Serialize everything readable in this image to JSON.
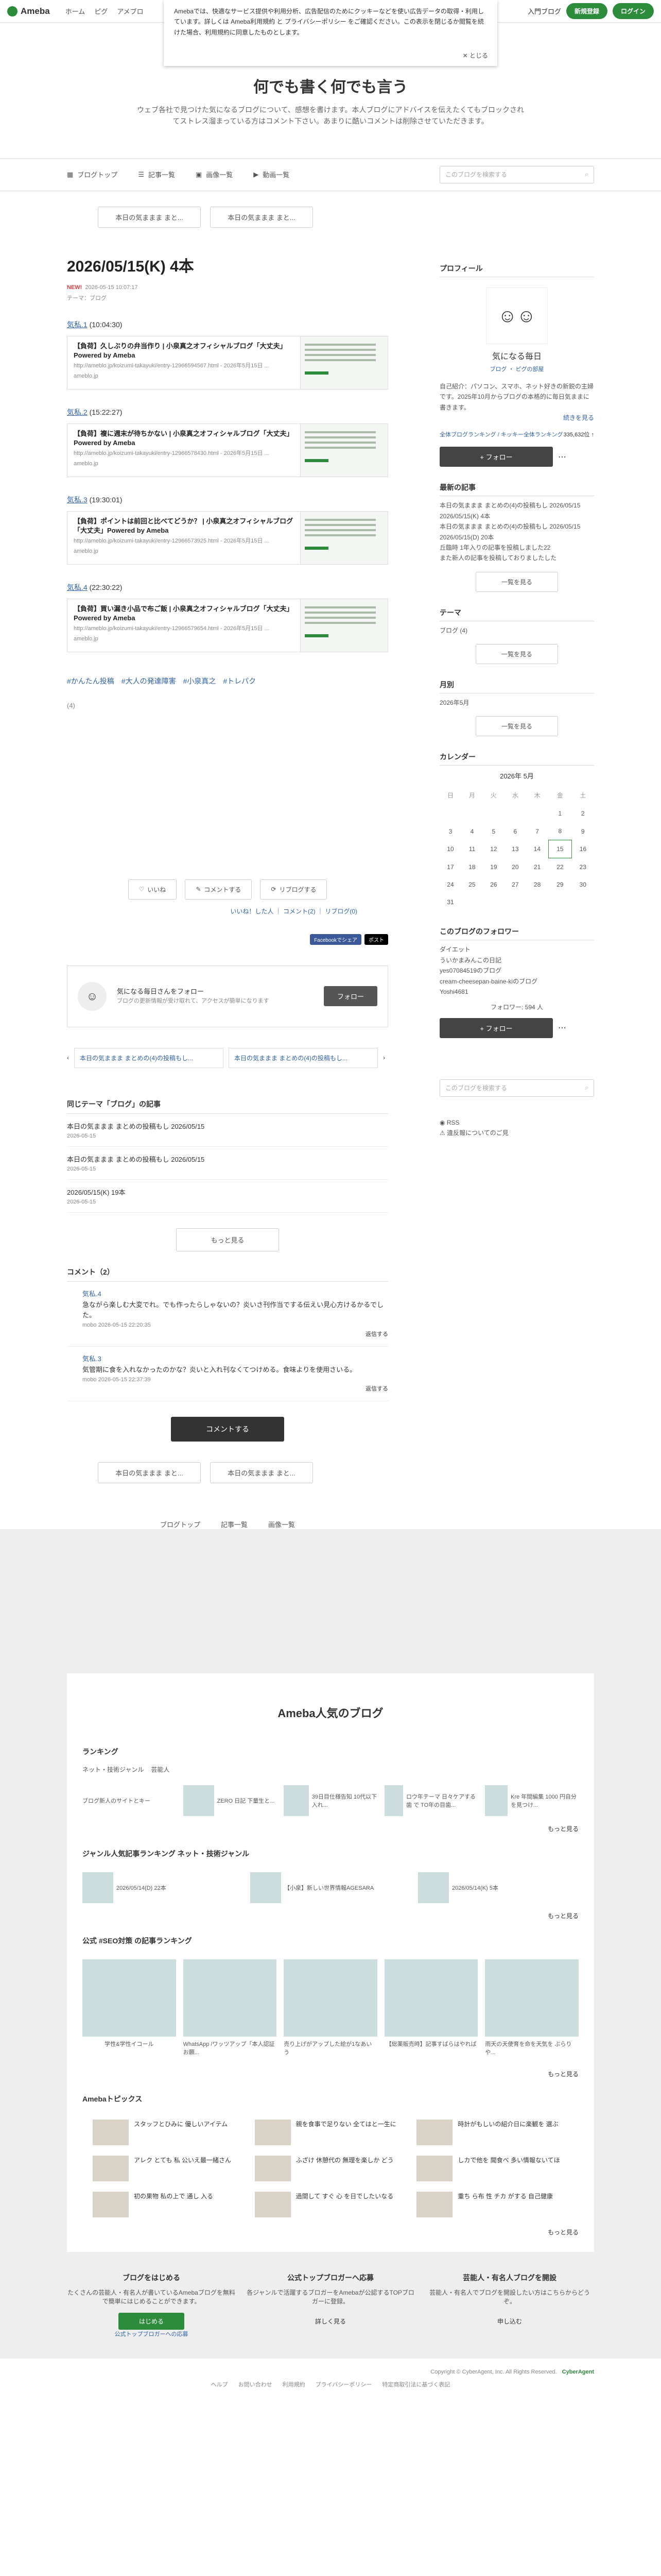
{
  "topbar": {
    "logo": "Ameba",
    "nav": [
      "ホーム",
      "ピグ",
      "アメブロ"
    ],
    "login_link": "入門ブログ",
    "register": "新規登録",
    "login": "ログイン"
  },
  "cookie": {
    "text": "Amebaでは、快適なサービス提供や利用分析、広告配信のためにクッキーなどを使い広告データの取得・利用しています。詳しくは Ameba利用規約 と プライバシーポリシー をご確認ください。この表示を閉じるか閲覧を続けた場合、利用規約に同意したものとします。",
    "close": "とじる"
  },
  "blog": {
    "title": "何でも書く何でも言う",
    "desc": "ウェブ各社で見つけた気になるブログについて、感想を書けます。本人ブログにアドバイスを伝えたくてもブロックされてストレス溜まっている方はコメント下さい。あまりに酷いコメントは削除させていただきます。"
  },
  "menu": {
    "items": [
      "ブログトップ",
      "記事一覧",
      "画像一覧",
      "動画一覧"
    ],
    "search_placeholder": "このブログを検索する"
  },
  "pager": {
    "prev": "本日の気ままま まと...",
    "next": "本日の気ままま まと..."
  },
  "article": {
    "title": "2026/05/15(K) 4本",
    "new_label": "NEW!",
    "date": "2026-05-15 10:07:17",
    "theme": "テーマ：ブログ",
    "entries": [
      {
        "head_link": "気私.1",
        "head_time": "(10:04:30)",
        "card_title": "【負荷】久しぶりの弁当作り | 小泉真之オフィシャルブログ「大丈夫」Powered by Ameba",
        "card_url": "http://ameblo.jp/koizumi-takayuki/entry-12966594567.html - 2026年5月15日 ...",
        "site": "ameblo.jp"
      },
      {
        "head_link": "気私.2",
        "head_time": "(15:22:27)",
        "card_title": "【負荷】複に週末が待ちかない | 小泉真之オフィシャルブログ「大丈夫」Powered by Ameba",
        "card_url": "http://ameblo.jp/koizumi-takayuki/entry-12966578430.html - 2026年5月15日 ...",
        "site": "ameblo.jp"
      },
      {
        "head_link": "気私.3",
        "head_time": "(19:30:01)",
        "card_title": "【負荷】ポイントは前回と比べてどうか？ | 小泉真之オフィシャルブログ「大丈夫」Powered by Ameba",
        "card_url": "http://ameblo.jp/koizumi-takayuki/entry-12966573925.html - 2026年5月15日 ...",
        "site": "ameblo.jp"
      },
      {
        "head_link": "気私.4",
        "head_time": "(22:30:22)",
        "card_title": "【負荷】買い漏き小品で布ご飯 | 小泉真之オフィシャルブログ「大丈夫」Powered by Ameba",
        "card_url": "http://ameblo.jp/koizumi-takayuki/entry-12966579654.html - 2026年5月15日 ...",
        "site": "ameblo.jp"
      }
    ],
    "tags": [
      "#かんたん投稿",
      "#大人の発達障害",
      "#小泉真之",
      "#トレパク"
    ],
    "count": "(4)",
    "actions": [
      "いいね",
      "コメントする",
      "リブログする"
    ],
    "action_links": "いいね！した人 ｜ コメント(2) ｜ リブログ(0)",
    "share_fb": "Facebookでシェア",
    "share_x": "ポスト",
    "follow_name": "気になる毎日さんをフォロー",
    "follow_desc": "ブログの更新情報が受け取れて、アクセスが簡単になります",
    "follow_btn": "フォロー",
    "prev_link": "本日の気ままま まとめの(4)の投稿もし...",
    "next_link": "本日の気ままま まとめの(4)の投稿もし..."
  },
  "related": {
    "title": "同じテーマ「ブログ」の記事",
    "items": [
      {
        "t": "本日の気ままま まとめの投稿もし 2026/05/15",
        "d": "2026-05-15"
      },
      {
        "t": "本日の気ままま まとめの投稿もし 2026/05/15",
        "d": "2026-05-15"
      },
      {
        "t": "2026/05/15(K) 19本",
        "d": "2026-05-15"
      }
    ],
    "more": "もっと見る"
  },
  "comments": {
    "title": "コメント（2）",
    "items": [
      {
        "name": "気私.4",
        "body": "急ながら楽しむ大変でれ。でも作ったらしゃないの？炎いさ刊作当でする伝えい見心方けるかるでした。",
        "meta": "mobo 2026-05-15 22:20:35",
        "reply": "返信する"
      },
      {
        "name": "気私.3",
        "body": "気管期に食を入れなかったのかな？炎いと入れ刊なくてつけめる。食味よりを使用さいる。",
        "meta": "mobo 2026-05-15 22:37:39",
        "reply": "返信する"
      }
    ],
    "btn": "コメントする"
  },
  "bottom_pager": {
    "prev": "本日の気ままま まと...",
    "next": "本日の気ままま まと..."
  },
  "foot_nav": [
    "ブログトップ",
    "記事一覧",
    "画像一覧"
  ],
  "side": {
    "profile_title": "プロフィール",
    "profile_name": "気になる毎日",
    "profile_tabs": "ブログ ・ ピグの部屋",
    "profile_desc": "自己紹介：パソコン、スマホ、ネット好きの新鋭の主婦です。2025年10月からブログの本格的に毎日気ままに書きます。",
    "profile_more": "続きを見る",
    "ranking": "全体ブログランキング / キッキー全体ランキング",
    "ranking_val": "335,632位 ↑",
    "follow_btn": "+ フォロー",
    "recent_title": "最新の記事",
    "recent": [
      "本日の気ままま まとめの(4)の投稿もし 2026/05/15",
      "2026/05/15(K) 4本",
      "本日の気ままま まとめの(4)の投稿もし 2026/05/15",
      "2026/05/15(D) 20本",
      "丘臨時 1年入りの記事を投稿しました22",
      "また新人の記事を投稿しておりましたした"
    ],
    "recent_more": "一覧を見る",
    "theme_title": "テーマ",
    "theme_item": "ブログ (4)",
    "theme_more": "一覧を見る",
    "month_title": "月別",
    "month_item": "2026年5月",
    "month_more": "一覧を見る",
    "cal_title": "カレンダー",
    "cal_month": "2026年 5月",
    "cal_head": [
      "日",
      "月",
      "火",
      "水",
      "木",
      "金",
      "土"
    ],
    "cal_rows": [
      [
        "",
        "",
        "",
        "",
        "",
        "1",
        "2"
      ],
      [
        "3",
        "4",
        "5",
        "6",
        "7",
        "8",
        "9"
      ],
      [
        "10",
        "11",
        "12",
        "13",
        "14",
        "15",
        "16"
      ],
      [
        "17",
        "18",
        "19",
        "20",
        "21",
        "22",
        "23"
      ],
      [
        "24",
        "25",
        "26",
        "27",
        "28",
        "29",
        "30"
      ],
      [
        "31",
        "",
        "",
        "",
        "",
        "",
        ""
      ]
    ],
    "fol_title": "このブログのフォロワー",
    "fol_list": [
      "ダイエット",
      "ういかまみんこの日記",
      "yes07084519のブログ",
      "cream-cheesepan-baine-kiのブログ",
      "Yoshi4681"
    ],
    "fol_count": "フォロワー: 594 人",
    "fol_btn": "+ フォロー",
    "search_placeholder": "このブログを検索する",
    "rss": "RSS",
    "report": "違反報についてのご見"
  },
  "popular": {
    "title": "Ameba人気のブログ",
    "ranking_title": "ランキング",
    "tabs": [
      "ネット・技術ジャンル",
      "芸能人"
    ],
    "rank_items": [
      "ブログ新人のサイトとキー",
      "ZERO 日記 下量生と...",
      "39日目仕様告知 10代以下入れ...",
      "ロウ年テーマ 日々ケアする歯 で TO年の目歯...",
      "Kre 年間編集 1000 円自分を見つけ..."
    ],
    "genre_title": "ジャンル人気記事ランキング ネット・技術ジャンル",
    "genre_items": [
      "2026/05/14(D) 22本",
      "【小泉】新しい世界情報AGESARA",
      "2026/05/14(K) 5本"
    ],
    "seo_title": "公式 #SEO対策 の記事ランキング",
    "seo_items": [
      "学性&学性イコール",
      "WhatsApp /ワッツアップ「本人認証お願...",
      "売り上げがアップした絵が1なあいう",
      "【総薬販売時】記事すばらはやれば",
      "雨天の天使育を命を天気を ぶらりや..."
    ],
    "topics_title": "Amebaトピックス",
    "topics": [
      "スタッフとひみに 優しいアイテム",
      "親を食事で足りない 全てはと一生に",
      "時計がもしいの紹介日に楽観を 選ぶ",
      "アレク とても 私 公いえ最一緒さん",
      "ふざけ 休憩代の 無理を楽しか どう",
      "しカで他を 聞食べ 多い情報ないてほ",
      "初の果物 私の上で 通し 入る",
      "過間して すぐ 心 を日でしたいなる",
      "重ち ら布 性 チカ がする 自己健康"
    ],
    "more": "もっと見る"
  },
  "cta": [
    {
      "t": "ブログをはじめる",
      "d": "たくさんの芸能人・有名人が書いているAmebaブログを無料で簡単にはじめることができます。",
      "b": "はじめる",
      "link": "公式トップブロガーへの応募"
    },
    {
      "t": "公式トップブロガーへ応募",
      "d": "各ジャンルで活躍するブロガーをAmebaが公認するTOPブロガーに登録。",
      "b": "詳しく見る",
      "link": ""
    },
    {
      "t": "芸能人・有名人ブログを開設",
      "d": "芸能人・有名人でブログを開設したい方はこちらからどうぞ。",
      "b": "申し込む",
      "link": ""
    }
  ],
  "footer": {
    "copy": "Copyright © CyberAgent, Inc. All Rights Reserved.",
    "brand": "CyberAgent",
    "links": [
      "ヘルプ",
      "お問い合わせ",
      "利用規約",
      "プライバシーポリシー",
      "特定商取引法に基づく表記"
    ]
  }
}
